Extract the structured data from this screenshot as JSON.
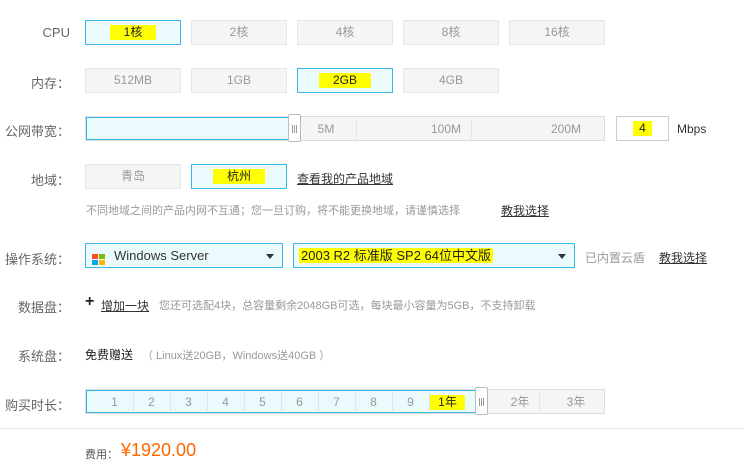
{
  "cpu": {
    "label": "CPU",
    "options": [
      "1核",
      "2核",
      "4核",
      "8核",
      "16核"
    ],
    "selected": "1核"
  },
  "memory": {
    "label": "内存：",
    "options": [
      "512MB",
      "1GB",
      "2GB",
      "4GB"
    ],
    "selected": "2GB"
  },
  "bandwidth": {
    "label": "公网带宽：",
    "ticks": [
      "5M",
      "100M",
      "200M"
    ],
    "value": "4",
    "unit": "Mbps",
    "slider_level_mbps": 4
  },
  "region": {
    "label": "地域：",
    "options": [
      "青岛",
      "杭州"
    ],
    "selected": "杭州",
    "view_link": "查看我的产品地域",
    "note": "不同地域之间的产品内网不互通；您一旦订购，将不能更换地域，请谨慎选择",
    "help_link": "教我选择"
  },
  "os": {
    "label": "操作系统：",
    "os_type": "Windows Server",
    "os_version": "2003 R2 标准版 SP2 64位中文版",
    "note": "已内置云盾",
    "help_link": "教我选择"
  },
  "data_disk": {
    "label": "数据盘：",
    "add_label": "增加一块",
    "note": "您还可选配4块，总容量剩余2048GB可选，每块最小容量为5GB，不支持卸载"
  },
  "system_disk": {
    "label": "系统盘：",
    "value": "免费赠送",
    "note": "（ Linux送20GB，Windows送40GB ）"
  },
  "duration": {
    "label": "购买时长：",
    "months": [
      "1",
      "2",
      "3",
      "4",
      "5",
      "6",
      "7",
      "8",
      "9",
      "1年"
    ],
    "years": [
      "2年",
      "3年"
    ],
    "selected": "1年"
  },
  "fee": {
    "label": "费用：",
    "amount": "¥1920.00"
  },
  "colors": {
    "accent": "#38b7e8",
    "highlight": "#ffff00",
    "price": "#ff6600"
  }
}
